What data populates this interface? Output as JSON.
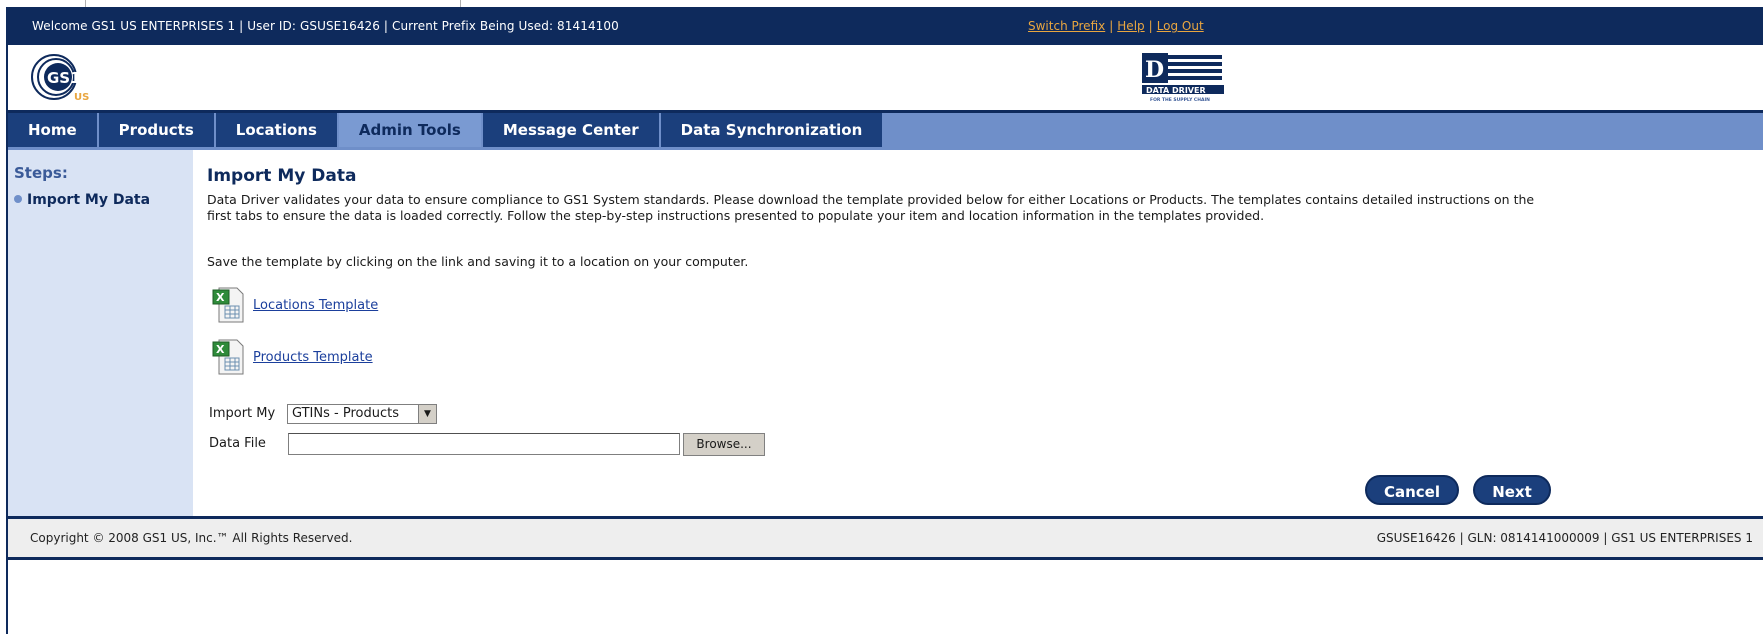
{
  "header": {
    "welcome_text": "Welcome GS1 US ENTERPRISES 1 | User ID: GSUSE16426 | Current Prefix Being Used: 81414100",
    "links": [
      "Switch Prefix",
      "Help",
      "Log Out"
    ],
    "separator": "|"
  },
  "logos": {
    "gs1_text": "GS1",
    "gs1_sub": "US",
    "datadriver_text": "DATA DRIVER",
    "datadriver_sub": "FOR THE SUPPLY CHAIN"
  },
  "nav": {
    "tabs": [
      "Home",
      "Products",
      "Locations",
      "Admin Tools",
      "Message Center",
      "Data Synchronization"
    ],
    "active_tab": "Admin Tools"
  },
  "sidebar": {
    "title": "Steps:",
    "items": [
      "Import My Data"
    ]
  },
  "main": {
    "title": "Import My Data",
    "intro": "Data Driver validates your data to ensure compliance to GS1 System standards. Please download the template provided below for either Locations or Products. The templates contains detailed instructions on the first tabs to ensure the data is loaded correctly. Follow the step-by-step instructions presented to populate your item and location information in the templates provided.",
    "save_instruction": "Save the template by clicking on the link and saving it to a location on your computer.",
    "templates": [
      "Locations Template",
      "Products Template"
    ],
    "import_label": "Import My",
    "import_value": "GTINs - Products",
    "datafile_label": "Data File",
    "datafile_value": "",
    "browse_label": "Browse...",
    "cancel_label": "Cancel",
    "next_label": "Next"
  },
  "footer": {
    "copyright": "Copyright © 2008 GS1 US, Inc.™ All Rights Reserved.",
    "account": "GSUSE16426 | GLN: 0814141000009 | GS1 US ENTERPRISES 1"
  },
  "colors": {
    "header_bg": "#0e2a5c",
    "nav_bg": "#6f8fc9",
    "tab_bg": "#1b3f7c",
    "link_orange": "#e9a640",
    "sidebar_bg": "#d9e3f4"
  }
}
